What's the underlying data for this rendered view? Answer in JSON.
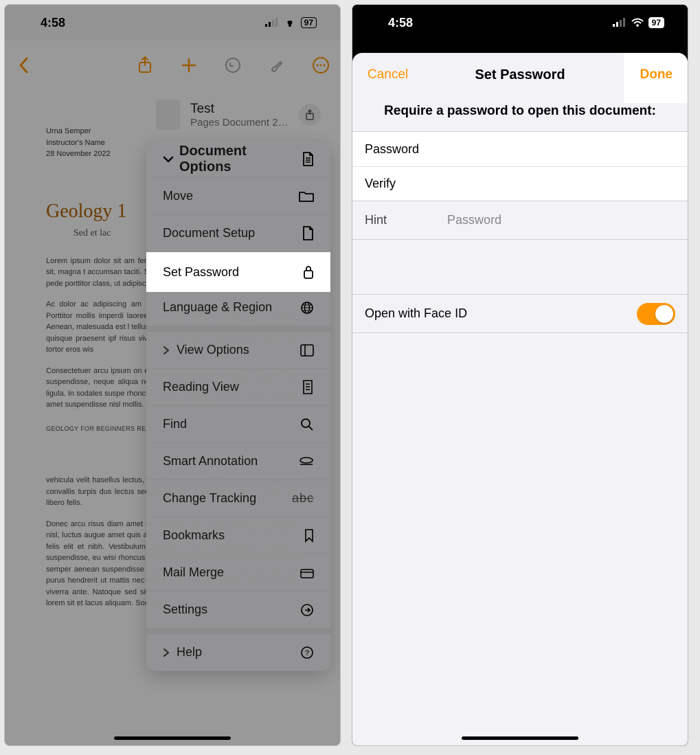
{
  "colors": {
    "accent": "#ff9500"
  },
  "left": {
    "status": {
      "time": "4:58",
      "battery": "97"
    },
    "toolbar_icons": [
      "share",
      "plus",
      "undo",
      "brush",
      "ellipsis"
    ],
    "document": {
      "meta_author": "Urna Semper",
      "meta_role": "Instructor's Name",
      "meta_date": "28 November 2022",
      "heading": "Geology 1",
      "subheading": "Sed et lac",
      "para1": "Lorem ipsum dolor sit am fermentum, enim integer ad enim nunc ultrices sit, magna t accumsan taciti. Sociis mauris i dolor sociis mauris, vel eu liber pede porttitor class, ut adipiscin dui. Enim eros in vel, volutpat",
      "para2": "Ac dolor ac adipiscing am pharetra sodales, feugiat ullamco tincidunt. Porttitor mollis imperdi laoreet, vehicula eleifend. Repellat mauris platea. Aenean, malesuada est l tellus lobortis lacus amet arcu et. E porta egestas, quisque praesent ipf risus vivamus a dictumst congue mollis. Tortor vitae tortor eros wis",
      "para3": "Consectetuer arcu ipsum on erat felis wisi a risus. Justo ferment Mauris at suspendisse, neque aliqua nec amet, mil fermentum tempor felis in, sed ligula. In sodales suspe rhoncus diam nisi, porta lectus ele integer molestie, amet suspendisse nisl mollis. Suscipit nec ligula ipsu",
      "footer_text": "GEOLOGY FOR BEGINNERS REPO",
      "para4": "vehicula velit hasellus lectus, vestt consectetuer. Congue porta sceler arcu convallis turpis dus lectus sec dignissimos imperdiet, luctus ac e ridiculus libero felis.",
      "para5": "Donec arcu risus diam amet sit. Congue tortor risus vestibulum commodo nisl, luctus augue amet quis aenean maecenas sit, donec velit iusto, morbi felis elit et nibh. Vestibulum volutpat dui lacus consectetuer, mauris at suspendisse, eu wisi rhoncus nibh velit, posuere sem a sit. Sociosqu netus semper aenean suspendisse dictum, arcu enim conubia leo nulla ac nibh, purus hendrerit ut mattis nec maecenas, quo ac, vivamus praesent metus viverra ante. Natoque sed sit hendrerit, dapibus velit molestiae leo a, ut lorem sit et lacus aliquam. Sodales"
    },
    "sheet": {
      "file_name": "Test",
      "file_subtitle": "Pages Document   2…",
      "header": "Document Options",
      "rows": [
        {
          "label": "Move",
          "icon": "folder"
        },
        {
          "label": "Document Setup",
          "icon": "doc"
        },
        {
          "label": "Set Password",
          "icon": "lock",
          "highlight": true
        },
        {
          "label": "Language & Region",
          "icon": "globe"
        }
      ],
      "view_row": {
        "label": "View Options",
        "icon": "columns"
      },
      "more_rows": [
        {
          "label": "Reading View",
          "icon": "doc-list"
        },
        {
          "label": "Find",
          "icon": "search"
        },
        {
          "label": "Smart Annotation",
          "icon": "annotate"
        },
        {
          "label": "Change Tracking",
          "icon": "strike",
          "strike_text": "abc"
        },
        {
          "label": "Bookmarks",
          "icon": "bookmark"
        },
        {
          "label": "Mail Merge",
          "icon": "box"
        },
        {
          "label": "Settings",
          "icon": "arrow-circle"
        }
      ],
      "help_row": {
        "label": "Help",
        "icon": "question"
      }
    }
  },
  "right": {
    "status": {
      "time": "4:58",
      "battery": "97"
    },
    "nav": {
      "cancel": "Cancel",
      "title": "Set Password",
      "done": "Done"
    },
    "prompt": "Require a password to open this document:",
    "fields": {
      "password_label": "Password",
      "verify_label": "Verify",
      "hint_label": "Hint",
      "hint_placeholder": "Password"
    },
    "faceid_label": "Open with Face ID",
    "faceid_on": true
  }
}
